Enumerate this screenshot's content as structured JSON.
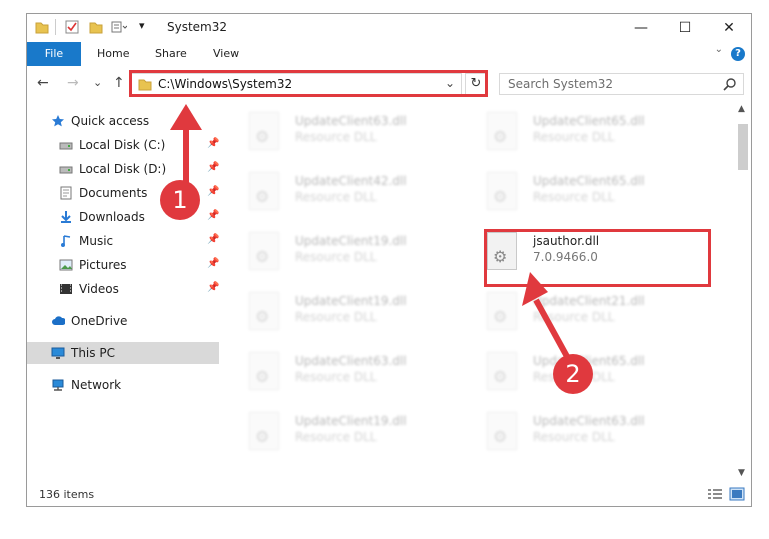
{
  "window": {
    "title": "System32",
    "quick_access_arrow": "▾",
    "controls": {
      "minimize": "—",
      "maximize": "☐",
      "close": "✕"
    }
  },
  "ribbon": {
    "tabs": [
      {
        "label": "File"
      },
      {
        "label": "Home"
      },
      {
        "label": "Share"
      },
      {
        "label": "View"
      }
    ],
    "help_label": "?",
    "collapse_label": "⌄"
  },
  "navigation": {
    "back": "←",
    "forward": "→",
    "recent": "⌄",
    "up": "↑",
    "address": "C:\\Windows\\System32",
    "address_dropdown": "⌄",
    "refresh": "↻",
    "search_placeholder": "Search System32"
  },
  "sidebar": {
    "items": [
      {
        "label": "Quick access",
        "icon": "star-icon",
        "pinned": false
      },
      {
        "label": "Local Disk (C:)",
        "icon": "drive-icon",
        "pinned": true
      },
      {
        "label": "Local Disk (D:)",
        "icon": "drive-icon",
        "pinned": true
      },
      {
        "label": "Documents",
        "icon": "documents-icon",
        "pinned": true
      },
      {
        "label": "Downloads",
        "icon": "download-icon",
        "pinned": true
      },
      {
        "label": "Music",
        "icon": "music-icon",
        "pinned": true
      },
      {
        "label": "Pictures",
        "icon": "pictures-icon",
        "pinned": true
      },
      {
        "label": "Videos",
        "icon": "video-icon",
        "pinned": true
      },
      {
        "label": "OneDrive",
        "icon": "cloud-icon",
        "pinned": false
      },
      {
        "label": "This PC",
        "icon": "computer-icon",
        "pinned": false,
        "selected": true
      },
      {
        "label": "Network",
        "icon": "network-icon",
        "pinned": false
      }
    ],
    "pin_glyph": "📌"
  },
  "files": [
    {
      "name": "UpdateClient63.dll",
      "sub": "Resource DLL",
      "blurred": true
    },
    {
      "name": "UpdateClient65.dll",
      "sub": "Resource DLL",
      "blurred": true
    },
    {
      "name": "UpdateClient42.dll",
      "sub": "Resource DLL",
      "blurred": true
    },
    {
      "name": "UpdateClient65.dll",
      "sub": "Resource DLL",
      "blurred": true
    },
    {
      "name": "UpdateClient19.dll",
      "sub": "Resource DLL",
      "blurred": true
    },
    {
      "name": "jsauthor.dll",
      "sub": "7.0.9466.0",
      "blurred": false
    },
    {
      "name": "UpdateClient19.dll",
      "sub": "Resource DLL",
      "blurred": true
    },
    {
      "name": "UpdateClient21.dll",
      "sub": "Resource DLL",
      "blurred": true
    },
    {
      "name": "UpdateClient63.dll",
      "sub": "Resource DLL",
      "blurred": true
    },
    {
      "name": "UpdateClient65.dll",
      "sub": "Resource DLL",
      "blurred": true
    },
    {
      "name": "UpdateClient19.dll",
      "sub": "Resource DLL",
      "blurred": true
    },
    {
      "name": "UpdateClient63.dll",
      "sub": "Resource DLL",
      "blurred": true
    }
  ],
  "status": {
    "items_count": "136 items"
  },
  "annotations": {
    "step1": "1",
    "step2": "2"
  },
  "colors": {
    "accent": "#1979ca",
    "highlight": "#e0393e"
  }
}
